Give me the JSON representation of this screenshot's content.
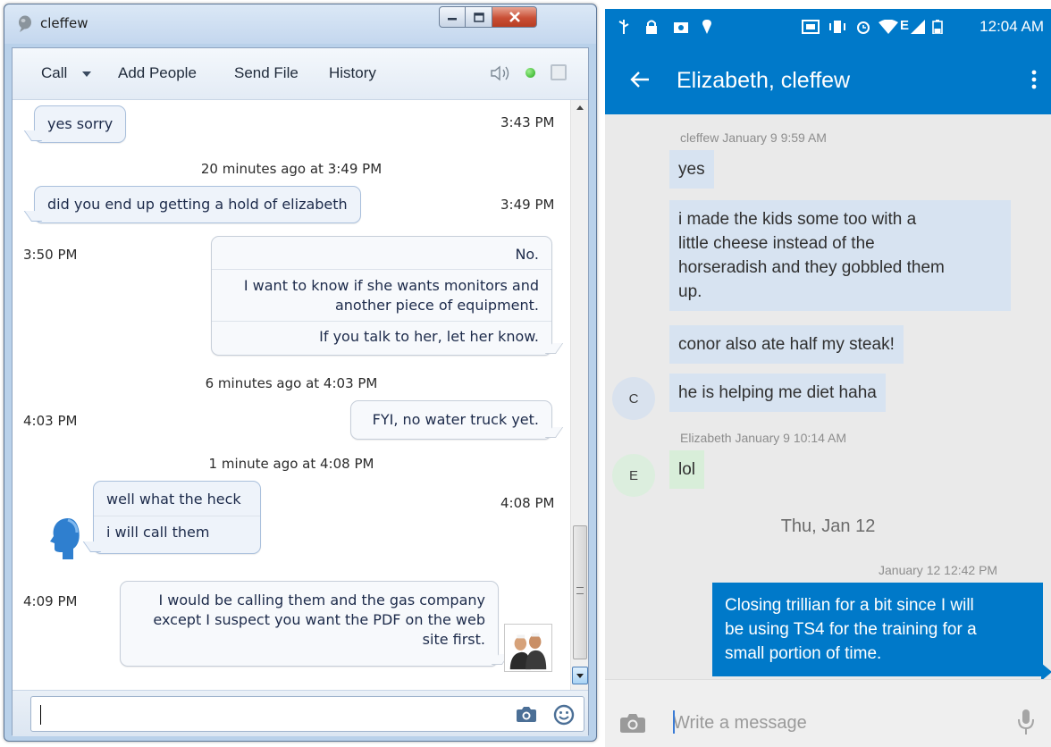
{
  "desktop": {
    "title": "cleffew",
    "toolbar": {
      "call": "Call",
      "add_people": "Add People",
      "send_file": "Send File",
      "history": "History"
    },
    "messages": [
      {
        "id": "m1",
        "text": [
          "yes sorry"
        ],
        "time": "3:43 PM"
      },
      {
        "id": "d1",
        "divider": "20 minutes ago at 3:49 PM"
      },
      {
        "id": "m2",
        "text": [
          "did you end up getting a hold of elizabeth"
        ],
        "time": "3:49 PM"
      },
      {
        "id": "m3",
        "time": "3:50 PM",
        "text": [
          "No.",
          "I want to know if she wants monitors and",
          "another piece of equipment.",
          "If you talk to her, let her know."
        ]
      },
      {
        "id": "d2",
        "divider": "6 minutes ago at 4:03 PM"
      },
      {
        "id": "m4",
        "time": "4:03 PM",
        "text": [
          "FYI, no water truck yet."
        ]
      },
      {
        "id": "d3",
        "divider": "1 minute ago at 4:08 PM"
      },
      {
        "id": "m5",
        "time": "4:08 PM",
        "text": [
          "well what the heck",
          "i will call them"
        ]
      },
      {
        "id": "m6",
        "time": "4:09 PM",
        "text": [
          "I would be calling them and the gas company",
          "except I suspect you want the PDF on the web",
          "site first."
        ]
      }
    ],
    "input": {
      "value": ""
    }
  },
  "phone": {
    "status_time": "12:04 AM",
    "conversation_title": "Elizabeth, cleffew",
    "thread": {
      "meta_1": "cleffew  January 9 9:59 AM",
      "msg_1": "yes",
      "msg_2_lines": [
        "i made the kids some too with a",
        "little cheese instead of the",
        "horseradish and they gobbled them",
        "up."
      ],
      "msg_3": "conor also ate half my steak!",
      "msg_4": "he is helping me diet haha",
      "avatar_c": "C",
      "meta_2": "Elizabeth  January 9 10:14 AM",
      "msg_5": "lol",
      "avatar_e": "E",
      "date_divider": "Thu, Jan 12",
      "meta_3": "January 12 12:42 PM",
      "sent_lines": [
        "Closing trillian for a bit since I will",
        "be using TS4 for the training for a",
        "small portion of time."
      ]
    },
    "composer": {
      "placeholder": "Write a message"
    }
  },
  "colors": {
    "phone_accent": "#0079c9",
    "online": "#24a81a",
    "close_button": "#c94f36"
  }
}
